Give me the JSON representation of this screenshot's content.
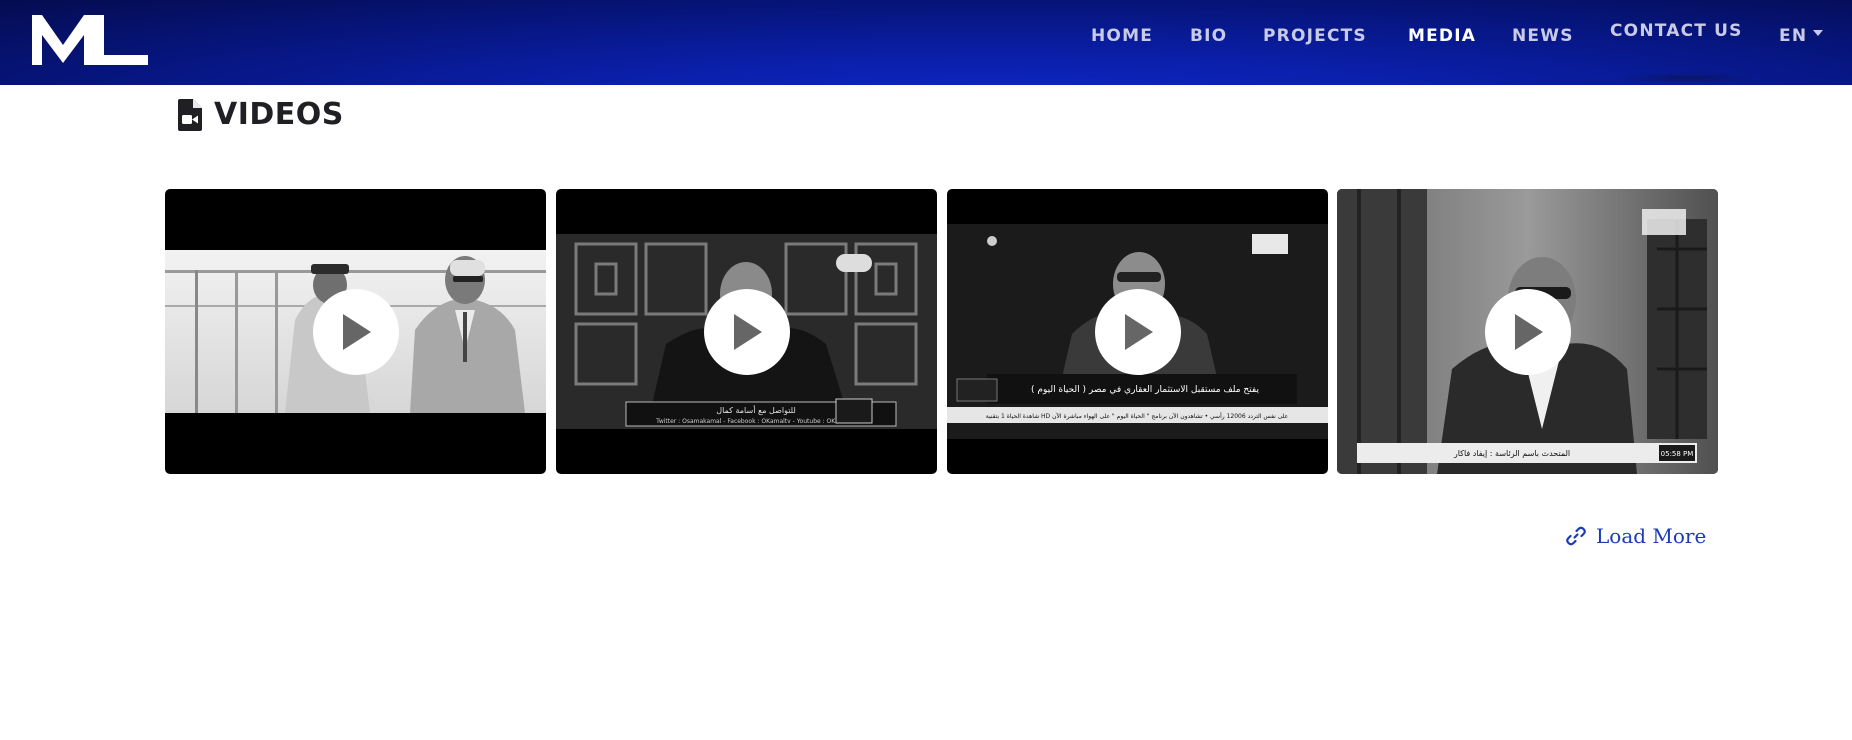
{
  "brand": {
    "logo_text": "ML"
  },
  "nav": {
    "items": [
      {
        "label": "HOME",
        "active": false
      },
      {
        "label": "BIO",
        "active": false
      },
      {
        "label": "PROJECTS",
        "active": false
      },
      {
        "label": "MEDIA",
        "active": true
      },
      {
        "label": "NEWS",
        "active": false
      },
      {
        "label": "CONTACT US",
        "active": false
      }
    ],
    "language": "EN"
  },
  "section": {
    "title": "VIDEOS",
    "icon": "file-video-icon"
  },
  "videos": [
    {
      "icon": "play-icon",
      "caption": "",
      "ticker": ""
    },
    {
      "icon": "play-icon",
      "caption": "للتواصل مع أسامة كمال",
      "ticker": "Twitter : Osamakamal  -  Facebook : OKamaltv  -  Youtube : OKamaltv"
    },
    {
      "icon": "play-icon",
      "caption": "( الحياة اليوم ) يفتح ملف مستقبل الاستثمار العقاري في مصر",
      "ticker": "شاهدة الحياة 1 بتقنية HD على نفس التردد 12006 رأسي  •  تشاهدون الآن برنامج \" الحياة اليوم \" على الهواء مباشرة الآن"
    },
    {
      "icon": "play-icon",
      "caption": "المتحدث باسم الرئاسة : إيفاد فاكار",
      "ticker": "05:58 PM"
    }
  ],
  "actions": {
    "load_more": "Load More",
    "load_more_icon": "link-icon"
  },
  "colors": {
    "navbar": "#061478",
    "link": "#1a3bb8",
    "title": "#1f1f24"
  }
}
